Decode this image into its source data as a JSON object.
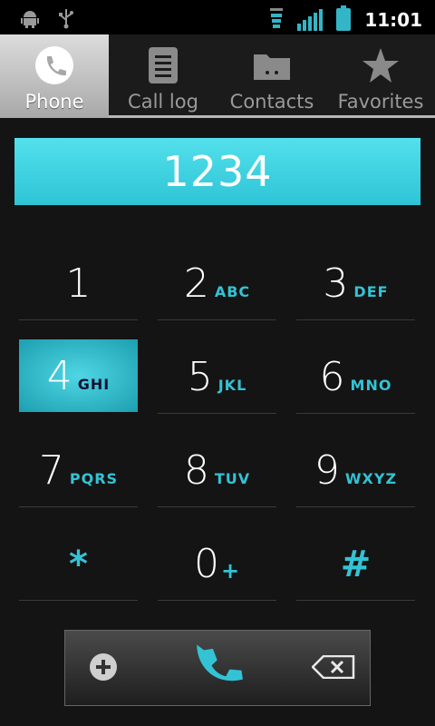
{
  "status_bar": {
    "time": "11:01",
    "icons": [
      "android-debug-icon",
      "usb-icon",
      "data-activity-icon",
      "signal-icon",
      "battery-icon"
    ],
    "accent": "#33b5c8"
  },
  "tabs": [
    {
      "label": "Phone",
      "icon": "phone-icon",
      "active": true
    },
    {
      "label": "Call log",
      "icon": "call-log-icon",
      "active": false
    },
    {
      "label": "Contacts",
      "icon": "contacts-icon",
      "active": false
    },
    {
      "label": "Favorites",
      "icon": "star-icon",
      "active": false
    }
  ],
  "display": {
    "number": "1234"
  },
  "keypad": [
    {
      "digit": "1",
      "letters": ""
    },
    {
      "digit": "2",
      "letters": "ABC"
    },
    {
      "digit": "3",
      "letters": "DEF"
    },
    {
      "digit": "4",
      "letters": "GHI"
    },
    {
      "digit": "5",
      "letters": "JKL"
    },
    {
      "digit": "6",
      "letters": "MNO"
    },
    {
      "digit": "7",
      "letters": "PQRS"
    },
    {
      "digit": "8",
      "letters": "TUV"
    },
    {
      "digit": "9",
      "letters": "WXYZ"
    },
    {
      "digit": "*",
      "letters": ""
    },
    {
      "digit": "0",
      "letters": "+"
    },
    {
      "digit": "#",
      "letters": ""
    }
  ],
  "pressed_key": "4",
  "bottom_bar": {
    "left_icon": "add-contact-icon",
    "center_icon": "call-icon",
    "right_icon": "backspace-icon"
  },
  "colors": {
    "accent": "#33c3d4",
    "display_bg": "#3fd3e2",
    "background": "#141414"
  }
}
